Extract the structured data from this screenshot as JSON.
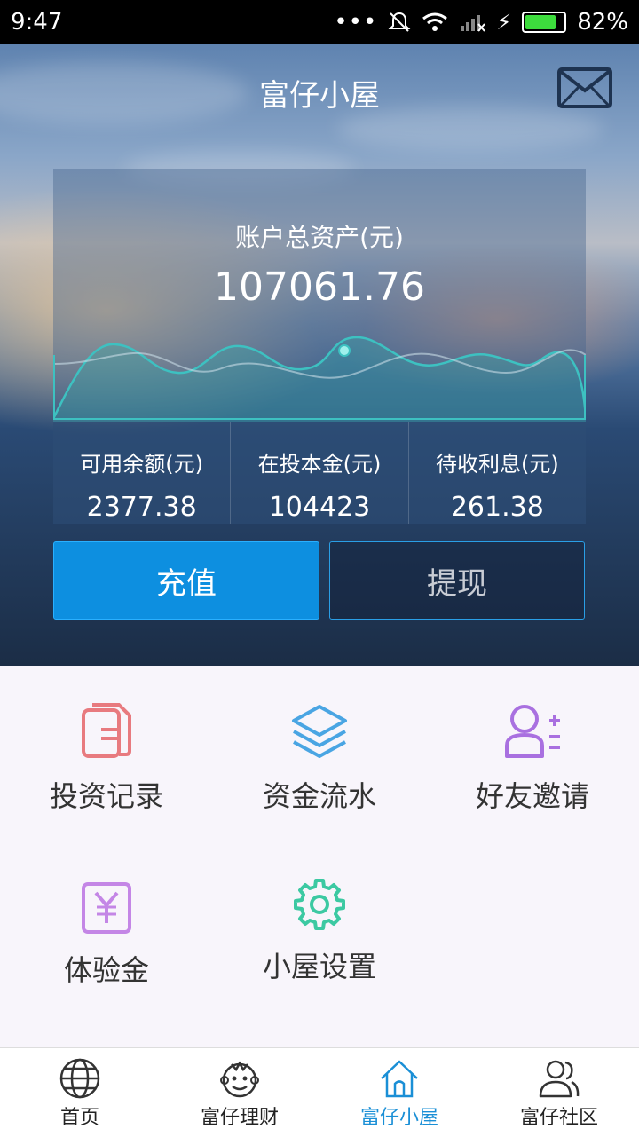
{
  "status_bar": {
    "time": "9:47",
    "battery_percent": "82%",
    "battery_level": 0.82
  },
  "header": {
    "title": "富仔小屋",
    "mail_icon": "mail-icon"
  },
  "account": {
    "total_label": "账户总资产(元)",
    "total_value": "107061.76",
    "stats": [
      {
        "label": "可用余额(元)",
        "value": "2377.38"
      },
      {
        "label": "在投本金(元)",
        "value": "104423"
      },
      {
        "label": "待收利息(元)",
        "value": "261.38"
      }
    ]
  },
  "actions": {
    "recharge_label": "充值",
    "withdraw_label": "提现"
  },
  "menu": [
    {
      "label": "投资记录",
      "icon": "documents-icon",
      "color": "#e87a7f"
    },
    {
      "label": "资金流水",
      "icon": "layers-icon",
      "color": "#4aa5e3"
    },
    {
      "label": "好友邀请",
      "icon": "add-friend-icon",
      "color": "#a970e0"
    },
    {
      "label": "体验金",
      "icon": "yuan-voucher-icon",
      "color": "#c486e6"
    },
    {
      "label": "小屋设置",
      "icon": "gear-icon",
      "color": "#3cc9a2"
    }
  ],
  "tabs": [
    {
      "label": "首页",
      "icon": "globe-icon",
      "active": false
    },
    {
      "label": "富仔理财",
      "icon": "monkey-icon",
      "active": false
    },
    {
      "label": "富仔小屋",
      "icon": "house-icon",
      "active": true
    },
    {
      "label": "富仔社区",
      "icon": "users-icon",
      "active": false
    }
  ],
  "colors": {
    "accent": "#1a8fd6",
    "primary_button": "#0d8fe0",
    "chart_line": "#3dc1c1"
  }
}
